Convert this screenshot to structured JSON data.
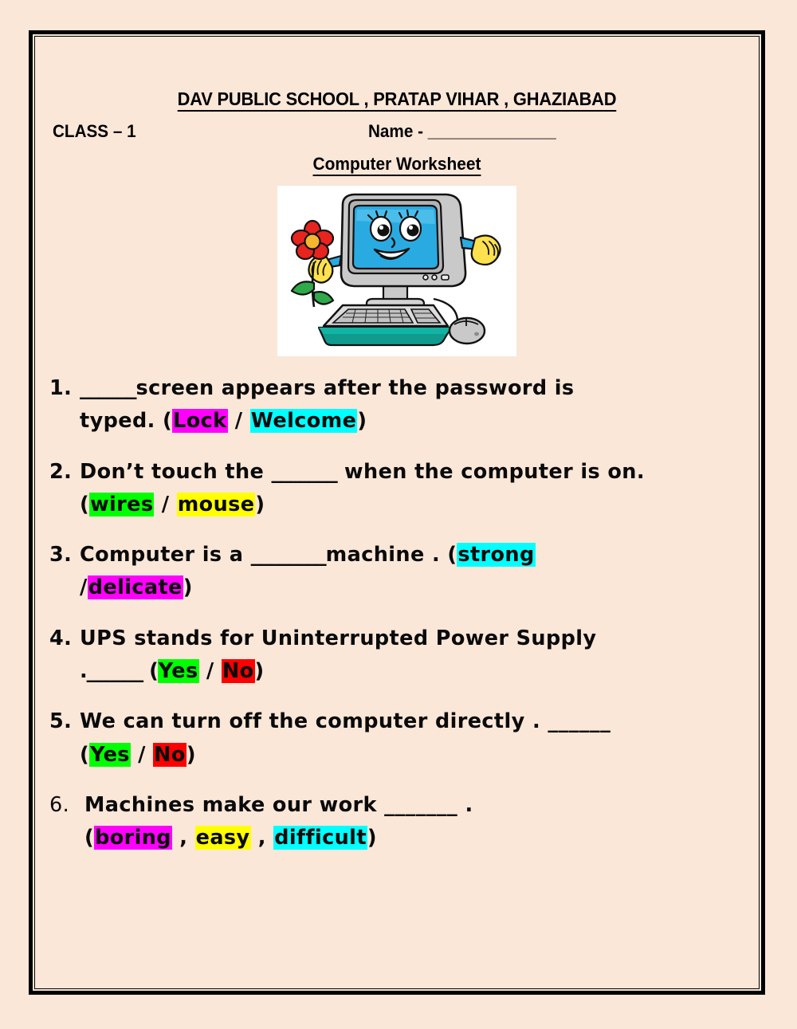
{
  "page": {
    "background_color": "#fae7d8",
    "border_color": "#000000"
  },
  "header": {
    "school_title": "DAV PUBLIC SCHOOL , PRATAP VIHAR , GHAZIABAD",
    "class_label": "CLASS – 1",
    "name_label": "Name - ______________",
    "worksheet_subtitle": "Computer Worksheet"
  },
  "illustration": {
    "alt": "cartoon computer with smiling face holding a red flower",
    "icon_name": "cartoon-computer-illustration",
    "background_color": "#ffffff",
    "screen_color": "#29abe2",
    "body_color": "#c6c6c6",
    "base_color": "#0f9b8e",
    "flower_color": "#e8241f",
    "glove_color": "#ffe14d"
  },
  "highlight_colors": {
    "magenta": "#ff00ff",
    "cyan": "#00ffff",
    "green": "#00ff00",
    "yellow": "#ffff00",
    "red": "#ff0000"
  },
  "questions": [
    {
      "number": "1.",
      "line1_a": "______",
      "line1_b": "screen appears after the password is",
      "line2_pre": "typed. (",
      "opt1": "Lock",
      "opt1_color": "magenta",
      "sep1": " / ",
      "opt2": "Welcome",
      "opt2_color": "cyan",
      "line2_post": ")"
    },
    {
      "number": "2.",
      "line1_a": "Don’t touch the ",
      "line1_blank": "_______",
      "line1_b": " when the computer is on.",
      "line2_pre": "(",
      "opt1": "wires",
      "opt1_color": "green",
      "sep1": " / ",
      "opt2": "mouse",
      "opt2_color": "yellow",
      "line2_post": ")"
    },
    {
      "number": "3.",
      "line1_a": "Computer is a ",
      "line1_blank": "________",
      "line1_b": "machine . (",
      "opt1": "strong",
      "opt1_color": "cyan",
      "line2_pre": "/",
      "opt2": "delicate",
      "opt2_color": "magenta",
      "line2_post": ")"
    },
    {
      "number": "4.",
      "line1": "UPS stands for Uninterrupted Power Supply",
      "line2_pre": ".______ (",
      "opt1": "Yes",
      "opt1_color": "green",
      "sep1": " / ",
      "opt2": "No",
      "opt2_color": "red",
      "line2_post": ")"
    },
    {
      "number": "5.",
      "line1": " We can turn off the computer directly . ______",
      "line2_pre": "(",
      "opt1": "Yes",
      "opt1_color": "green",
      "sep1": " / ",
      "opt2": "No",
      "opt2_color": "red",
      "line2_post": ")"
    },
    {
      "number": "6.",
      "line1": " Machines make our work _______ .",
      "line2_pre": " (",
      "opt1": "boring",
      "opt1_color": "magenta",
      "sep1": " , ",
      "opt2": "easy",
      "opt2_color": "yellow",
      "sep2": " , ",
      "opt3": "difficult",
      "opt3_color": "cyan",
      "line2_post": ")"
    }
  ]
}
